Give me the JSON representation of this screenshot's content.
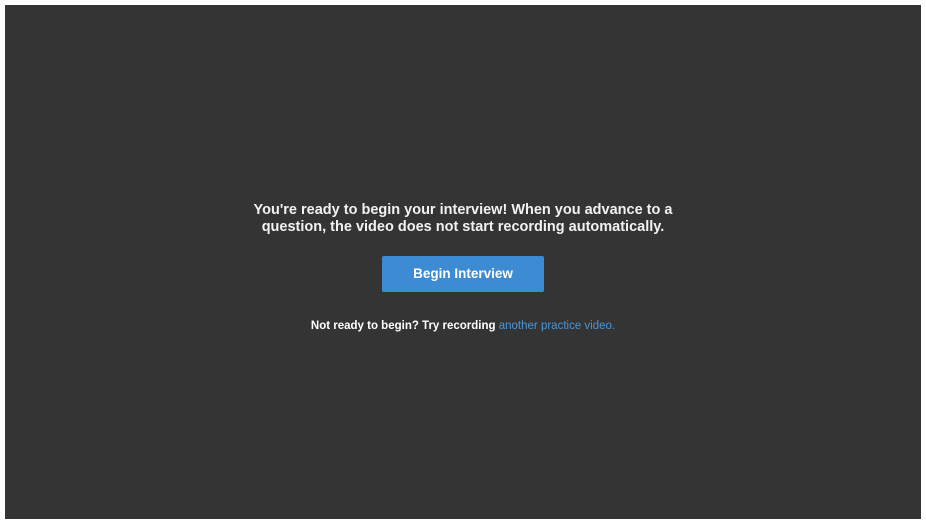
{
  "interview": {
    "message_line1": "You're ready to begin your interview! When you advance to a",
    "message_line2": "question, the video does not start recording automatically.",
    "begin_button_label": "Begin Interview",
    "practice_prompt": "Not ready to begin? Try recording ",
    "practice_link_label": "another practice video."
  },
  "colors": {
    "background": "#343434",
    "button": "#3d8cd3",
    "link": "#4d95d8"
  }
}
